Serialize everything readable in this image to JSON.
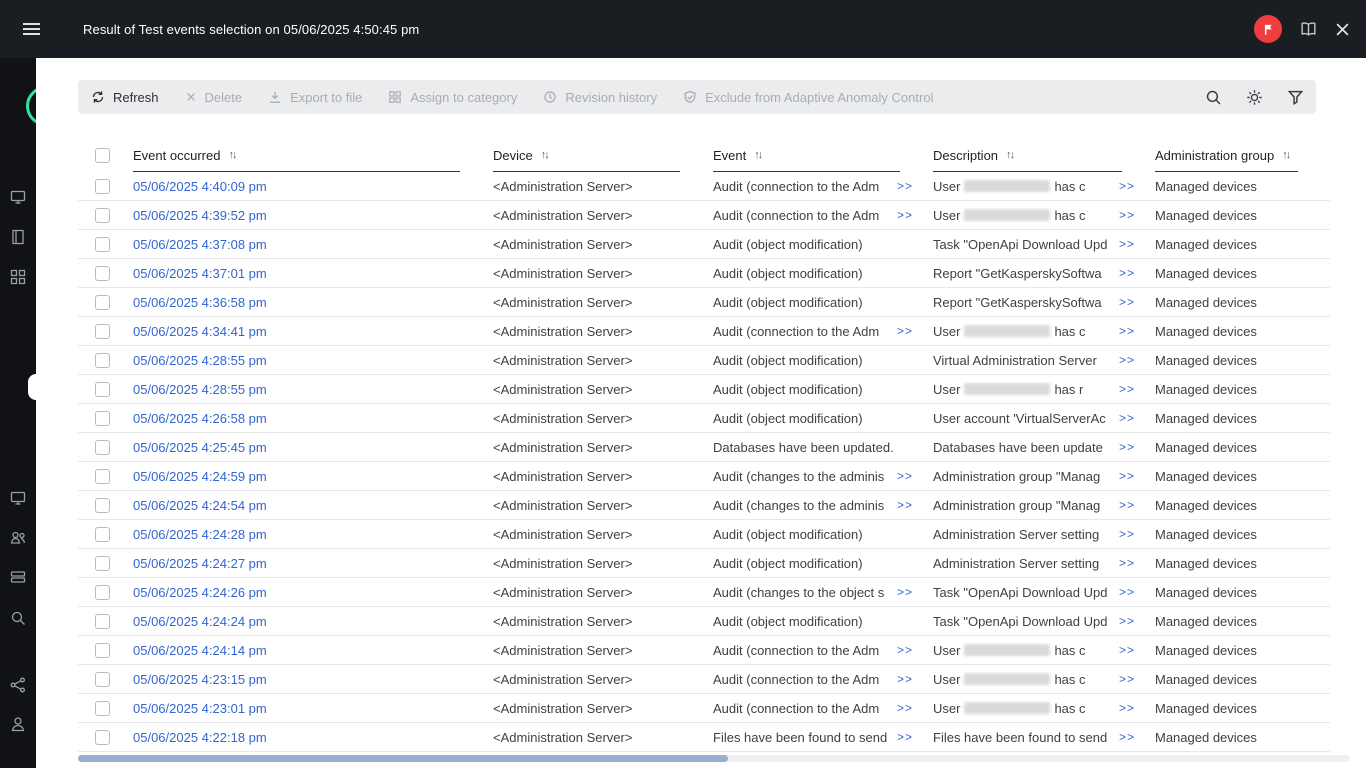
{
  "header": {
    "title": "Result of Test events selection on 05/06/2025 4:50:45 pm"
  },
  "toolbar": {
    "buttons": [
      {
        "label": "Refresh",
        "enabled": true
      },
      {
        "label": "Delete",
        "enabled": false
      },
      {
        "label": "Export to file",
        "enabled": false
      },
      {
        "label": "Assign to category",
        "enabled": false
      },
      {
        "label": "Revision history",
        "enabled": false
      },
      {
        "label": "Exclude from Adaptive Anomaly Control",
        "enabled": false
      }
    ]
  },
  "table": {
    "more_label": ">>",
    "columns": [
      {
        "label": "Event occurred"
      },
      {
        "label": "Device"
      },
      {
        "label": "Event"
      },
      {
        "label": "Description"
      },
      {
        "label": "Administration group"
      }
    ],
    "rows": [
      {
        "time": "05/06/2025 4:40:09 pm",
        "device": "<Administration Server>",
        "event": "Audit (connection to the Adm",
        "event_more": true,
        "desc_prefix": "User",
        "redacted": true,
        "desc_suffix": "has c",
        "desc_more": true,
        "group": "Managed devices"
      },
      {
        "time": "05/06/2025 4:39:52 pm",
        "device": "<Administration Server>",
        "event": "Audit (connection to the Adm",
        "event_more": true,
        "desc_prefix": "User",
        "redacted": true,
        "desc_suffix": "has c",
        "desc_more": true,
        "group": "Managed devices"
      },
      {
        "time": "05/06/2025 4:37:08 pm",
        "device": "<Administration Server>",
        "event": "Audit (object modification)",
        "event_more": false,
        "desc_prefix": "Task \"OpenApi Download Upd",
        "redacted": false,
        "desc_suffix": "",
        "desc_more": true,
        "group": "Managed devices"
      },
      {
        "time": "05/06/2025 4:37:01 pm",
        "device": "<Administration Server>",
        "event": "Audit (object modification)",
        "event_more": false,
        "desc_prefix": "Report \"GetKasperskySoftwa",
        "redacted": false,
        "desc_suffix": "",
        "desc_more": true,
        "group": "Managed devices"
      },
      {
        "time": "05/06/2025 4:36:58 pm",
        "device": "<Administration Server>",
        "event": "Audit (object modification)",
        "event_more": false,
        "desc_prefix": "Report \"GetKasperskySoftwa",
        "redacted": false,
        "desc_suffix": "",
        "desc_more": true,
        "group": "Managed devices"
      },
      {
        "time": "05/06/2025 4:34:41 pm",
        "device": "<Administration Server>",
        "event": "Audit (connection to the Adm",
        "event_more": true,
        "desc_prefix": "User",
        "redacted": true,
        "desc_suffix": "has c",
        "desc_more": true,
        "group": "Managed devices"
      },
      {
        "time": "05/06/2025 4:28:55 pm",
        "device": "<Administration Server>",
        "event": "Audit (object modification)",
        "event_more": false,
        "desc_prefix": "Virtual Administration Server",
        "redacted": false,
        "desc_suffix": "",
        "desc_more": true,
        "group": "Managed devices"
      },
      {
        "time": "05/06/2025 4:28:55 pm",
        "device": "<Administration Server>",
        "event": "Audit (object modification)",
        "event_more": false,
        "desc_prefix": "User",
        "redacted": true,
        "desc_suffix": "has r",
        "desc_more": true,
        "group": "Managed devices"
      },
      {
        "time": "05/06/2025 4:26:58 pm",
        "device": "<Administration Server>",
        "event": "Audit (object modification)",
        "event_more": false,
        "desc_prefix": "User account 'VirtualServerAc",
        "redacted": false,
        "desc_suffix": "",
        "desc_more": true,
        "group": "Managed devices"
      },
      {
        "time": "05/06/2025 4:25:45 pm",
        "device": "<Administration Server>",
        "event": "Databases have been updated.",
        "event_more": false,
        "desc_prefix": "Databases have been update",
        "redacted": false,
        "desc_suffix": "",
        "desc_more": true,
        "group": "Managed devices"
      },
      {
        "time": "05/06/2025 4:24:59 pm",
        "device": "<Administration Server>",
        "event": "Audit (changes to the adminis",
        "event_more": true,
        "desc_prefix": "Administration group \"Manag",
        "redacted": false,
        "desc_suffix": "",
        "desc_more": true,
        "group": "Managed devices"
      },
      {
        "time": "05/06/2025 4:24:54 pm",
        "device": "<Administration Server>",
        "event": "Audit (changes to the adminis",
        "event_more": true,
        "desc_prefix": "Administration group \"Manag",
        "redacted": false,
        "desc_suffix": "",
        "desc_more": true,
        "group": "Managed devices"
      },
      {
        "time": "05/06/2025 4:24:28 pm",
        "device": "<Administration Server>",
        "event": "Audit (object modification)",
        "event_more": false,
        "desc_prefix": "Administration Server setting",
        "redacted": false,
        "desc_suffix": "",
        "desc_more": true,
        "group": "Managed devices"
      },
      {
        "time": "05/06/2025 4:24:27 pm",
        "device": "<Administration Server>",
        "event": "Audit (object modification)",
        "event_more": false,
        "desc_prefix": "Administration Server setting",
        "redacted": false,
        "desc_suffix": "",
        "desc_more": true,
        "group": "Managed devices"
      },
      {
        "time": "05/06/2025 4:24:26 pm",
        "device": "<Administration Server>",
        "event": "Audit (changes to the object s",
        "event_more": true,
        "desc_prefix": "Task \"OpenApi Download Upd",
        "redacted": false,
        "desc_suffix": "",
        "desc_more": true,
        "group": "Managed devices"
      },
      {
        "time": "05/06/2025 4:24:24 pm",
        "device": "<Administration Server>",
        "event": "Audit (object modification)",
        "event_more": false,
        "desc_prefix": "Task \"OpenApi Download Upd",
        "redacted": false,
        "desc_suffix": "",
        "desc_more": true,
        "group": "Managed devices"
      },
      {
        "time": "05/06/2025 4:24:14 pm",
        "device": "<Administration Server>",
        "event": "Audit (connection to the Adm",
        "event_more": true,
        "desc_prefix": "User",
        "redacted": true,
        "desc_suffix": "has c",
        "desc_more": true,
        "group": "Managed devices"
      },
      {
        "time": "05/06/2025 4:23:15 pm",
        "device": "<Administration Server>",
        "event": "Audit (connection to the Adm",
        "event_more": true,
        "desc_prefix": "User",
        "redacted": true,
        "desc_suffix": "has c",
        "desc_more": true,
        "group": "Managed devices"
      },
      {
        "time": "05/06/2025 4:23:01 pm",
        "device": "<Administration Server>",
        "event": "Audit (connection to the Adm",
        "event_more": true,
        "desc_prefix": "User",
        "redacted": true,
        "desc_suffix": "has c",
        "desc_more": true,
        "group": "Managed devices"
      },
      {
        "time": "05/06/2025 4:22:18 pm",
        "device": "<Administration Server>",
        "event": "Files have been found to send",
        "event_more": true,
        "desc_prefix": "Files have been found to send",
        "redacted": false,
        "desc_suffix": "",
        "desc_more": true,
        "group": "Managed devices"
      }
    ]
  },
  "colors": {
    "accent_blue": "#3465d0",
    "brand_red": "#f03d3f",
    "brand_green": "#2fe3a0",
    "toolbar_bg": "#ebeced"
  }
}
